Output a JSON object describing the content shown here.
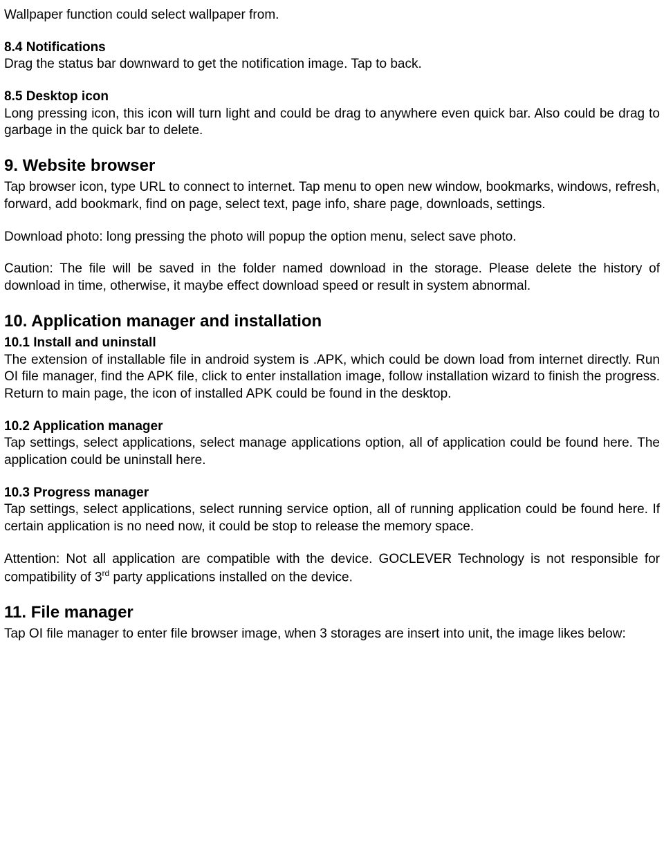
{
  "intro_line": "Wallpaper function could select wallpaper from.",
  "s84": {
    "head": "8.4 Notifications",
    "body": "Drag the status bar downward to get the notification image. Tap to back."
  },
  "s85": {
    "head": "8.5 Desktop icon",
    "body": "Long pressing icon, this icon will turn light and could be drag to anywhere even quick bar. Also could be drag to garbage in the quick bar to delete."
  },
  "s9": {
    "head": "9. Website browser",
    "p1": "Tap browser icon, type URL to connect to internet. Tap menu to open new window, bookmarks, windows, refresh, forward, add bookmark, find on page, select text, page info, share page, downloads, settings.",
    "p2": "Download photo: long pressing the photo will popup the option menu, select save photo.",
    "p3": "Caution: The file will be saved in the folder named download in the storage. Please delete the history of download in time, otherwise, it maybe effect download speed or result in system abnormal."
  },
  "s10": {
    "head": "10. Application manager and installation",
    "s101_head": "10.1 Install and uninstall",
    "s101_body": "The extension of installable file in android system is .APK, which could be down load from internet directly. Run OI file manager, find the APK file, click to enter installation image, follow installation wizard to finish the progress. Return to main page, the icon of installed APK could be found in the desktop.",
    "s102_head": "10.2 Application manager",
    "s102_body": "Tap settings, select applications, select manage applications option, all of application could be found here. The application could be uninstall here.",
    "s103_head": "10.3 Progress manager",
    "s103_body": "Tap settings, select applications, select running service option, all of running application could be found here. If certain application is no need now, it could be stop to release the memory space.",
    "attn_a": "Attention: Not all application are compatible with the device. GOCLEVER Technology is not responsible for compatibility of 3",
    "attn_sup": "rd",
    "attn_b": " party applications installed on the device."
  },
  "s11": {
    "head": "11. File manager",
    "body": "Tap OI file manager to enter file browser image, when 3 storages are insert into unit, the image likes below:"
  }
}
